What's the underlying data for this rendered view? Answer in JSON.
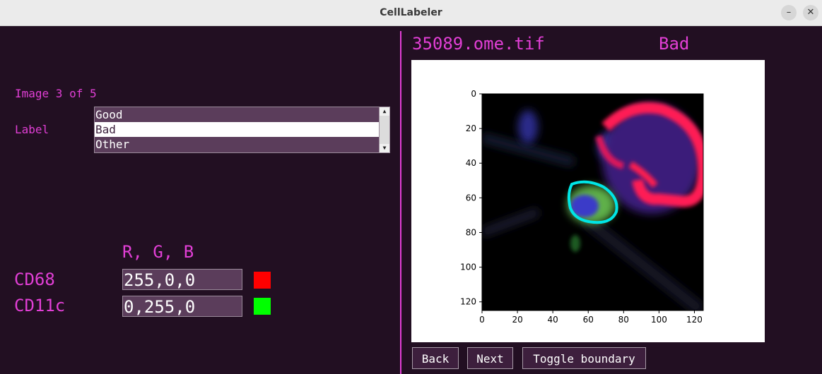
{
  "window": {
    "title": "CellLabeler",
    "minimize_label": "–",
    "close_label": "✕"
  },
  "left": {
    "image_counter": "Image 3 of 5",
    "label_caption": "Label",
    "label_options": [
      "Good",
      "Bad",
      "Other"
    ],
    "selected_label": "Bad",
    "rgb_header": "R, G, B",
    "channels": [
      {
        "name": "CD68",
        "value": "255,0,0",
        "color": "#ff0000"
      },
      {
        "name": "CD11c",
        "value": "0,255,0",
        "color": "#00ff00"
      }
    ]
  },
  "right": {
    "filename": "35089.ome.tif",
    "status_label": "Bad",
    "plot": {
      "x_ticks": [
        "0",
        "20",
        "40",
        "60",
        "80",
        "100",
        "120"
      ],
      "y_ticks": [
        "0",
        "20",
        "40",
        "60",
        "80",
        "100",
        "120"
      ],
      "boundary_color": "#00e5e5"
    },
    "buttons": {
      "back": "Back",
      "next": "Next",
      "toggle": "Toggle boundary"
    }
  },
  "colors": {
    "accent": "#e23fd6",
    "background": "#220f22"
  }
}
